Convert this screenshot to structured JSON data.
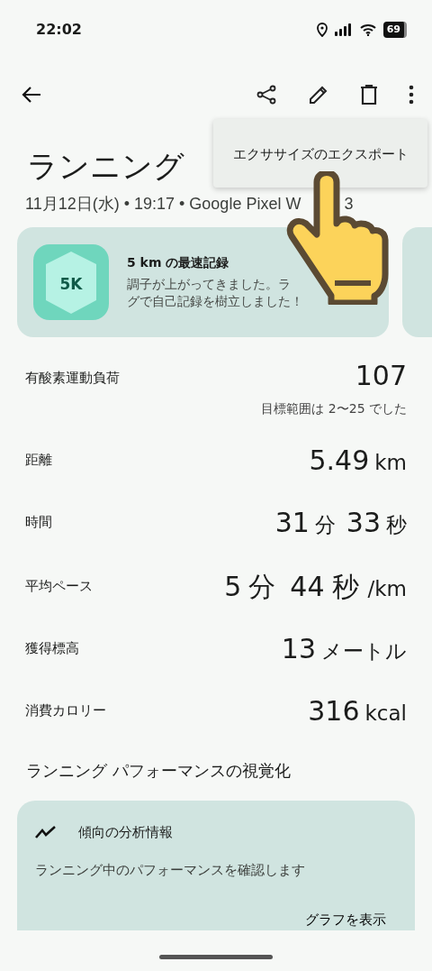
{
  "status_bar": {
    "time": "22:02",
    "battery": "69"
  },
  "menu": {
    "items": [
      {
        "label": "エクササイズのエクスポート"
      }
    ]
  },
  "title": "ランニング",
  "subtitle": {
    "text": "11月12日(水) • 19:17 • Google Pixel W",
    "tail": "3"
  },
  "achievement": {
    "badge": "5K",
    "title": "5 km の最速記録",
    "lines": [
      "調子が上がってきました。ラ",
      "グで自己記録を樹立しました！"
    ]
  },
  "metrics": [
    {
      "label": "有酸素運動負荷",
      "value": [
        {
          "text": "107",
          "kind": "number"
        }
      ],
      "note": "目標範囲は 2〜25 でした"
    },
    {
      "label": "距離",
      "value": [
        {
          "text": "5.49",
          "kind": "number"
        },
        {
          "text": "km",
          "kind": "unit"
        }
      ]
    },
    {
      "label": "時間",
      "value": [
        {
          "text": "31",
          "kind": "number"
        },
        {
          "text": "分",
          "kind": "unit"
        },
        {
          "text": "33",
          "kind": "number"
        },
        {
          "text": "秒",
          "kind": "unit"
        }
      ]
    },
    {
      "label": "平均ペース",
      "value": [
        {
          "text": "5",
          "kind": "number"
        },
        {
          "text": "分",
          "kind": "bigunit"
        },
        {
          "text": "44",
          "kind": "number"
        },
        {
          "text": "秒",
          "kind": "bigunit"
        },
        {
          "text": "/km",
          "kind": "unit"
        }
      ]
    },
    {
      "label": "獲得標高",
      "value": [
        {
          "text": "13",
          "kind": "number"
        },
        {
          "text": "メートル",
          "kind": "unit"
        }
      ]
    },
    {
      "label": "消費カロリー",
      "value": [
        {
          "text": "316",
          "kind": "number"
        },
        {
          "text": "kcal",
          "kind": "unit"
        }
      ]
    }
  ],
  "section_title": "ランニング パフォーマンスの視覚化",
  "trend_card": {
    "title": "傾向の分析情報",
    "description": "ランニング中のパフォーマンスを確認します",
    "action": "グラフを表示"
  }
}
